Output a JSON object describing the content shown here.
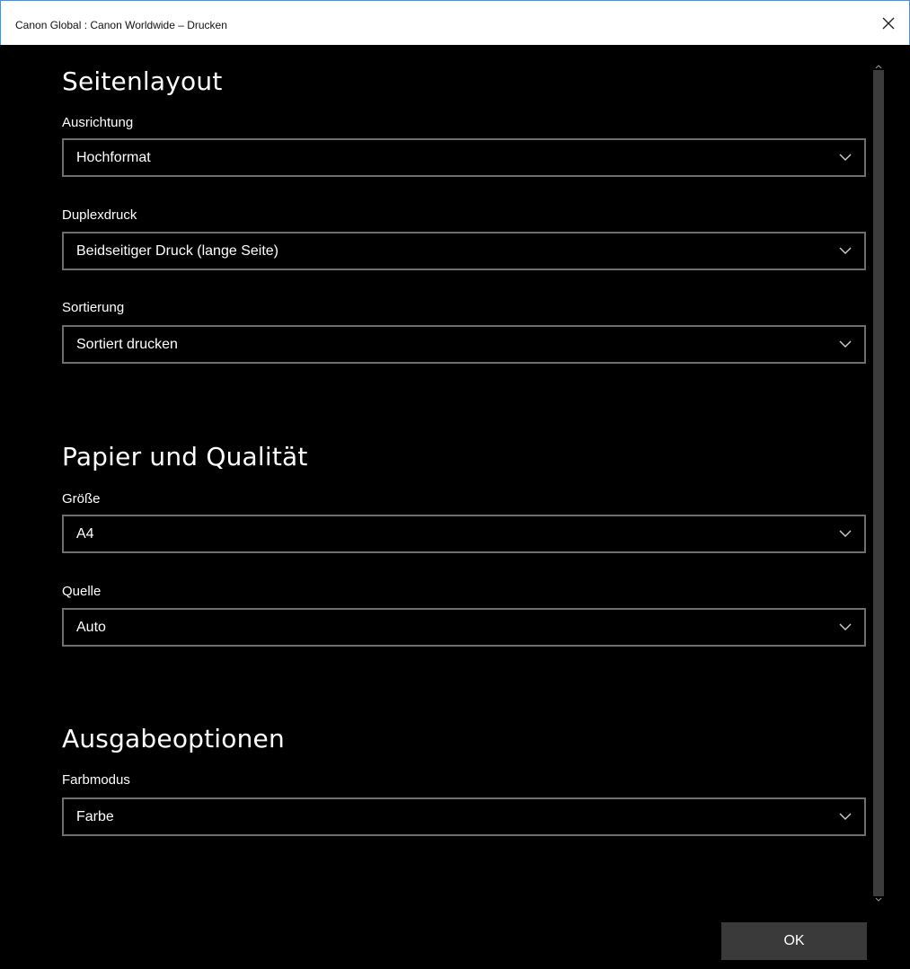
{
  "window": {
    "title": "Canon Global : Canon Worldwide – Drucken"
  },
  "sections": {
    "layout": {
      "title": "Seitenlayout",
      "orientation": {
        "label": "Ausrichtung",
        "value": "Hochformat"
      },
      "duplex": {
        "label": "Duplexdruck",
        "value": "Beidseitiger Druck (lange Seite)"
      },
      "collation": {
        "label": "Sortierung",
        "value": "Sortiert drucken"
      }
    },
    "paper": {
      "title": "Papier und Qualität",
      "size": {
        "label": "Größe",
        "value": "A4"
      },
      "source": {
        "label": "Quelle",
        "value": "Auto"
      }
    },
    "output": {
      "title": "Ausgabeoptionen",
      "color_mode": {
        "label": "Farbmodus",
        "value": "Farbe"
      }
    }
  },
  "footer": {
    "ok_label": "OK"
  },
  "icons": {
    "close": "close-icon",
    "chevron": "chevron-down-icon",
    "scroll_up": "scroll-up-icon",
    "scroll_down": "scroll-down-icon"
  },
  "colors": {
    "background": "#000000",
    "titlebar": "#ffffff",
    "select_border": "#6e6e6e",
    "button": "#3a3a3a"
  }
}
